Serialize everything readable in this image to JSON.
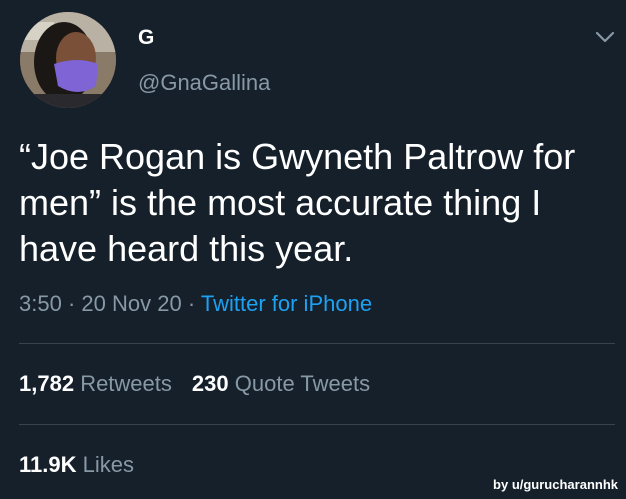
{
  "user": {
    "display_name": "G",
    "handle": "@GnaGallina",
    "avatar_icon": "profile-photo"
  },
  "tweet": {
    "text": "“Joe Rogan is Gwyneth Paltrow for men” is the most accurate thing I have heard this year.",
    "time": "3:50",
    "separator": "·",
    "date": "20 Nov 20",
    "source": "Twitter for iPhone"
  },
  "stats": {
    "retweets_count": "1,782",
    "retweets_label": "Retweets",
    "quotes_count": "230",
    "quotes_label": "Quote Tweets",
    "likes_count": "11.9K",
    "likes_label": "Likes"
  },
  "watermark": "by u/gurucharannhk",
  "colors": {
    "background": "#15202b",
    "text": "#ffffff",
    "secondary": "#8899a6",
    "link": "#1da1f2",
    "divider": "#38444d"
  }
}
